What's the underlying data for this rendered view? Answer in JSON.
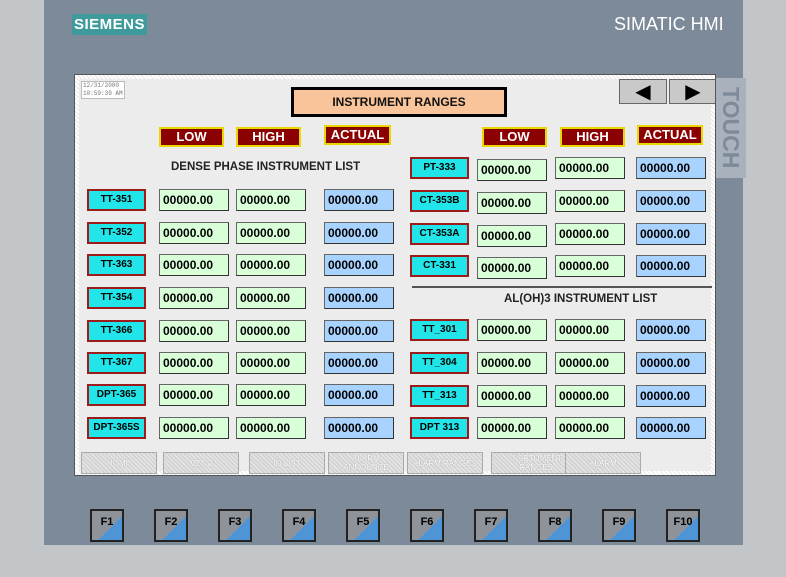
{
  "device": {
    "logo": "SIEMENS",
    "brand": "SIMATIC HMI",
    "touch": "TOUCH"
  },
  "screen": {
    "datetime": {
      "date": "12/31/2000",
      "time": "10:59:39 AM"
    },
    "title": "INSTRUMENT RANGES",
    "nav": {
      "prev": "◀",
      "next": "▶"
    },
    "headers": {
      "low": "LOW",
      "high": "HIGH",
      "actual": "ACTUAL"
    },
    "dense_phase": {
      "title": "DENSE PHASE INSTRUMENT LIST",
      "rows": [
        {
          "tag": "TT-351",
          "low": "00000.00",
          "high": "00000.00",
          "actual": "00000.00"
        },
        {
          "tag": "TT-352",
          "low": "00000.00",
          "high": "00000.00",
          "actual": "00000.00"
        },
        {
          "tag": "TT-363",
          "low": "00000.00",
          "high": "00000.00",
          "actual": "00000.00"
        },
        {
          "tag": "TT-354",
          "low": "00000.00",
          "high": "00000.00",
          "actual": "00000.00"
        },
        {
          "tag": "TT-366",
          "low": "00000.00",
          "high": "00000.00",
          "actual": "00000.00"
        },
        {
          "tag": "TT-367",
          "low": "00000.00",
          "high": "00000.00",
          "actual": "00000.00"
        },
        {
          "tag": "DPT-365",
          "low": "00000.00",
          "high": "00000.00",
          "actual": "00000.00"
        },
        {
          "tag": "DPT-365S",
          "low": "00000.00",
          "high": "00000.00",
          "actual": "00000.00"
        }
      ]
    },
    "right_top": {
      "rows": [
        {
          "tag": "PT-333",
          "low": "00000.00",
          "high": "00000.00",
          "actual": "00000.00"
        },
        {
          "tag": "CT-353B",
          "low": "00000.00",
          "high": "00000.00",
          "actual": "00000.00"
        },
        {
          "tag": "CT-353A",
          "low": "00000.00",
          "high": "00000.00",
          "actual": "00000.00"
        },
        {
          "tag": "CT-331",
          "low": "00000.00",
          "high": "00000.00",
          "actual": "00000.00"
        }
      ]
    },
    "aloh3": {
      "title": "AL(OH)3 INSTRUMENT LIST",
      "rows": [
        {
          "tag": "TT_301",
          "low": "00000.00",
          "high": "00000.00",
          "actual": "00000.00"
        },
        {
          "tag": "TT_304",
          "low": "00000.00",
          "high": "00000.00",
          "actual": "00000.00"
        },
        {
          "tag": "TT_313",
          "low": "00000.00",
          "high": "00000.00",
          "actual": "00000.00"
        },
        {
          "tag": "DPT 313",
          "low": "00000.00",
          "high": "00000.00",
          "actual": "00000.00"
        }
      ]
    },
    "bottom_buttons": [
      "HOME",
      "MENU",
      "IO LIST",
      "ALARM ANNOUNCE",
      "ALARM RANGES",
      "INSRTUMENT RANGES",
      "ALARM"
    ]
  },
  "function_keys": [
    "F1",
    "F2",
    "F3",
    "F4",
    "F5",
    "F6",
    "F7",
    "F8",
    "F9",
    "F10"
  ]
}
